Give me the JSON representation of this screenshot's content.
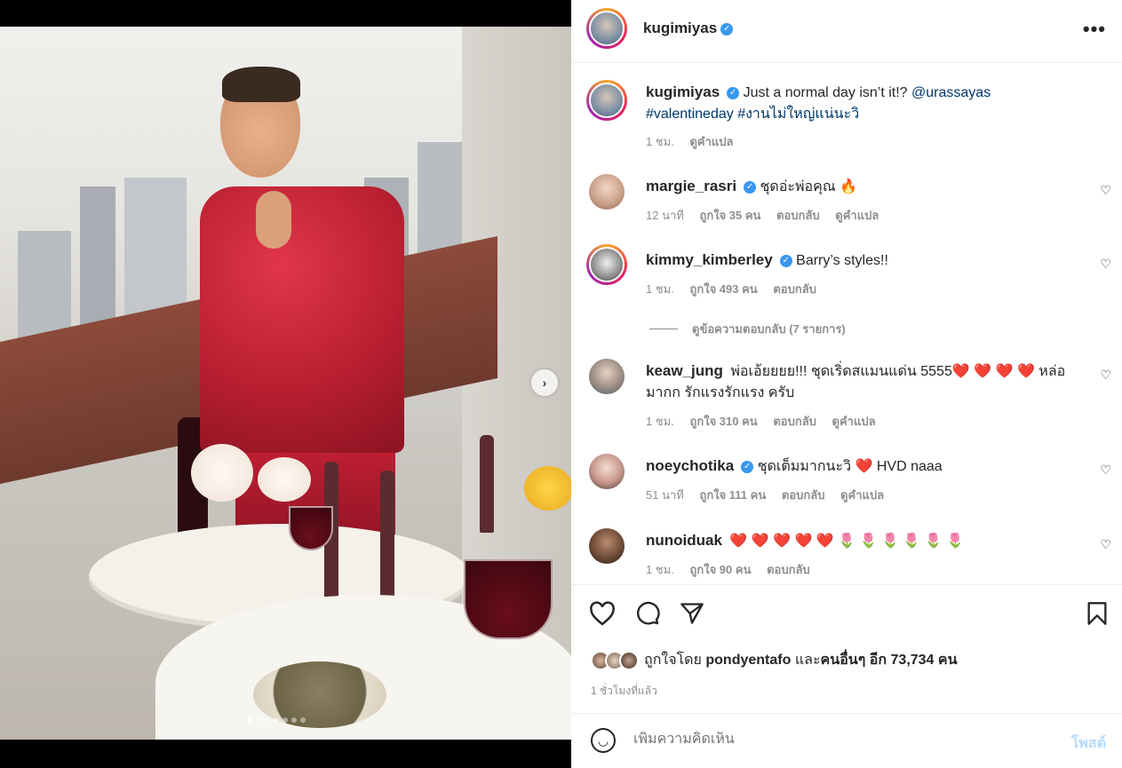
{
  "post": {
    "author": "kugimiyas",
    "more_icon": "more-icon",
    "caption_text": "Just a normal day isn’t it!?",
    "caption_mention": "@urassayas",
    "caption_tags": "#valentineday #งานไม่ใหญ่แน่นะวิ",
    "caption_time": "1 ชม.",
    "caption_translate": "ดูคำแปล"
  },
  "comments": [
    {
      "username": "margie_rasri",
      "text": "ชุดอ่ะพ่อคุณ 🔥",
      "time": "12 นาที",
      "likes": "ถูกใจ 35 คน",
      "reply": "ตอบกลับ",
      "translate": "ดูคำแปล"
    },
    {
      "username": "kimmy_kimberley",
      "text": "Barry’s styles!!",
      "time": "1 ชม.",
      "likes": "ถูกใจ 493 คน",
      "reply": "ตอบกลับ",
      "translate": ""
    },
    {
      "username": "keaw_jung",
      "text": "พ่อเอ้ยยยย!!! ชุดเริ่ดสแมนแด่น 5555❤️ ❤️ ❤️ ❤️ หล่อมากก รักแรงรักแรง ครับ",
      "time": "1 ชม.",
      "likes": "ถูกใจ 310 คน",
      "reply": "ตอบกลับ",
      "translate": "ดูคำแปล"
    },
    {
      "username": "noeychotika",
      "text": "ชุดเต็มมากนะวิ ❤️ HVD naaa",
      "time": "51 นาที",
      "likes": "ถูกใจ 111 คน",
      "reply": "ตอบกลับ",
      "translate": "ดูคำแปล"
    },
    {
      "username": "nunoiduak",
      "text": "❤️ ❤️ ❤️ ❤️ ❤️ 🌷 🌷 🌷 🌷 🌷 🌷",
      "time": "1 ชม.",
      "likes": "ถูกใจ 90 คน",
      "reply": "ตอบกลับ",
      "translate": ""
    }
  ],
  "view_replies": "ดูข้อความตอบกลับ (7 รายการ)",
  "likes_summary": {
    "prefix": "ถูกใจโดย",
    "user": "pondyentafo",
    "middle": "และ",
    "others": "คนอื่นๆ อีก 73,734 คน"
  },
  "posted_time": "1 ชั่วโมงที่แล้ว",
  "add_comment": {
    "placeholder": "เพิ่มความคิดเห็น",
    "post_label": "โพสต์"
  },
  "carousel": {
    "total": 7,
    "active": 1
  },
  "colors": {
    "accent": "#3897f0",
    "link": "#00376b",
    "muted": "#8e8e8e",
    "post_disabled": "#b3dbff"
  }
}
